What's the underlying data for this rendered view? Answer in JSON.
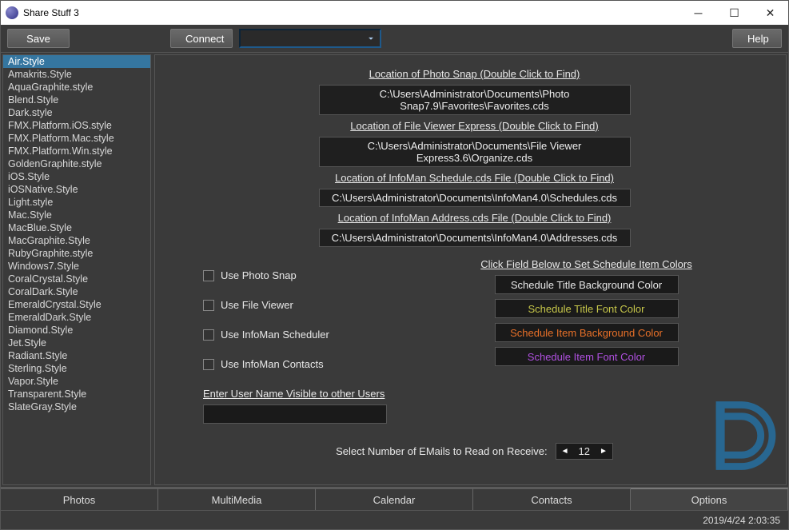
{
  "window": {
    "title": "Share Stuff 3"
  },
  "toolbar": {
    "save": "Save",
    "connect": "Connect",
    "help": "Help"
  },
  "styles": [
    "Air.Style",
    "Amakrits.Style",
    "AquaGraphite.style",
    "Blend.Style",
    "Dark.style",
    "FMX.Platform.iOS.style",
    "FMX.Platform.Mac.style",
    "FMX.Platform.Win.style",
    "GoldenGraphite.style",
    "iOS.Style",
    "iOSNative.Style",
    "Light.style",
    "Mac.Style",
    "MacBlue.Style",
    "MacGraphite.Style",
    "RubyGraphite.style",
    "Windows7.Style",
    "CoralCrystal.Style",
    "CoralDark.Style",
    "EmeraldCrystal.Style",
    "EmeraldDark.Style",
    "Diamond.Style",
    "Jet.Style",
    "Radiant.Style",
    "Sterling.Style",
    "Vapor.Style",
    "Transparent.Style",
    "SlateGray.Style"
  ],
  "selectedStyle": "Air.Style",
  "locations": {
    "photosnap_label": "Location of Photo Snap (Double Click to Find)",
    "photosnap_path": "C:\\Users\\Administrator\\Documents\\Photo Snap7.9\\Favorites\\Favorites.cds",
    "fileviewer_label": "Location of File Viewer Express (Double Click to Find)",
    "fileviewer_path": "C:\\Users\\Administrator\\Documents\\File Viewer Express3.6\\Organize.cds",
    "schedule_label": "Location of InfoMan Schedule.cds File  (Double Click to Find)",
    "schedule_path": "C:\\Users\\Administrator\\Documents\\InfoMan4.0\\Schedules.cds",
    "address_label": "Location of InfoMan Address.cds File  (Double Click to Find)",
    "address_path": "C:\\Users\\Administrator\\Documents\\InfoMan4.0\\Addresses.cds"
  },
  "checks": {
    "photosnap": "Use Photo Snap",
    "fileviewer": "Use File Viewer",
    "scheduler": "Use InfoMan Scheduler",
    "contacts": "Use InfoMan Contacts"
  },
  "colors": {
    "heading": "Click Field Below to Set Schedule Item Colors",
    "titleBg": {
      "label": "Schedule Title Background Color",
      "color": "#e8e8e8"
    },
    "titleFont": {
      "label": "Schedule Title Font Color",
      "color": "#c8c84a"
    },
    "itemBg": {
      "label": "Schedule Item Background Color",
      "color": "#e87028"
    },
    "itemFont": {
      "label": "Schedule Item Font Color",
      "color": "#b050e0"
    }
  },
  "username_label": "Enter User Name Visible to other Users",
  "email_label": "Select Number of EMails to Read on Receive:",
  "email_count": "12",
  "tabs": {
    "photos": "Photos",
    "multimedia": "MultiMedia",
    "calendar": "Calendar",
    "contacts": "Contacts",
    "options": "Options"
  },
  "status": {
    "datetime": "2019/4/24 2:03:35"
  }
}
